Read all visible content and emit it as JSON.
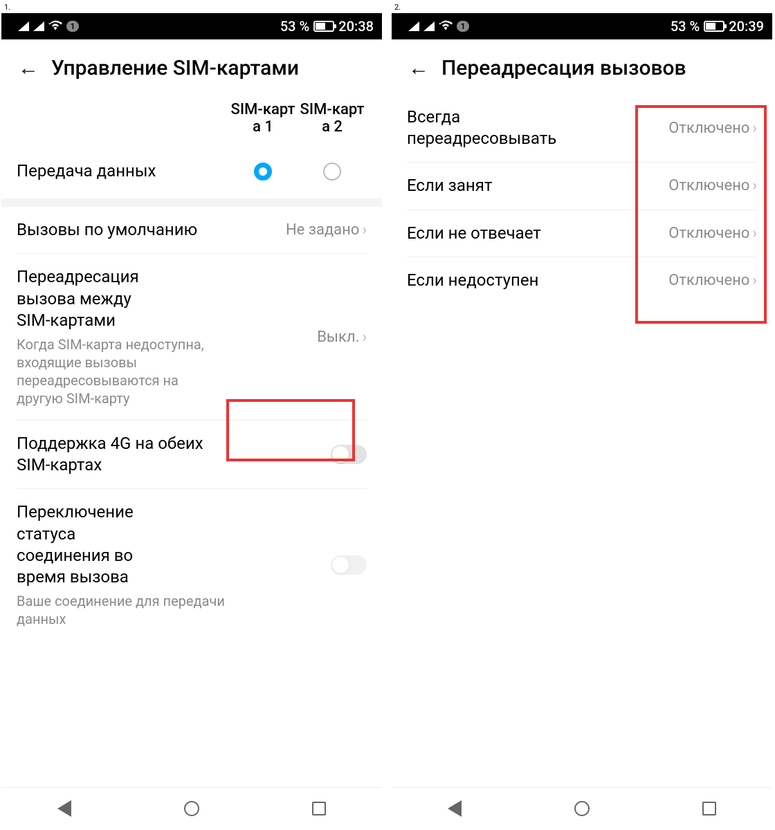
{
  "steps": {
    "one": "1.",
    "two": "2."
  },
  "status": {
    "battery_pct": "53 %",
    "time_left": "20:38",
    "time_right": "20:39",
    "sim_badge": "1"
  },
  "left": {
    "title": "Управление SIM-картами",
    "sim_col1": "SIM-карта 1",
    "sim_col2": "SIM-карта 2",
    "data_label": "Передача данных",
    "default_calls_label": "Вызовы по умолчанию",
    "default_calls_value": "Не задано",
    "fw_label": "Переадресация вызова между SIM-картами",
    "fw_sub": "Когда SIM-карта недоступна, входящие вызовы переадресовываются на другую SIM-карту",
    "fw_value": "Выкл.",
    "dual4g_label": "Поддержка 4G на обеих SIM-картах",
    "switch_label": "Переключение статуса соединения во время вызова",
    "switch_sub": "Ваше соединение для передачи данных"
  },
  "right": {
    "title": "Переадресация вызовов",
    "items": [
      {
        "label": "Всегда переадресовывать",
        "value": "Отключено"
      },
      {
        "label": "Если занят",
        "value": "Отключено"
      },
      {
        "label": "Если не отвечает",
        "value": "Отключено"
      },
      {
        "label": "Если недоступен",
        "value": "Отключено"
      }
    ]
  }
}
